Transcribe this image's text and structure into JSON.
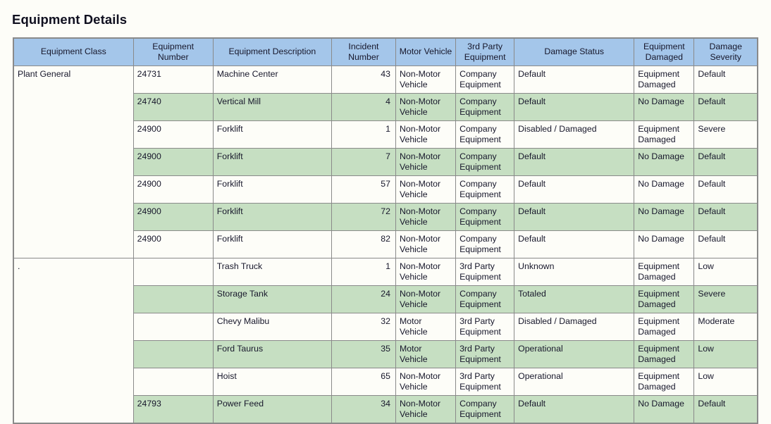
{
  "page": {
    "title": "Equipment Details"
  },
  "table": {
    "columns": [
      {
        "key": "equipment_class",
        "label": "Equipment Class"
      },
      {
        "key": "equipment_number",
        "label": "Equipment\nNumber"
      },
      {
        "key": "equipment_description",
        "label": "Equipment Description"
      },
      {
        "key": "incident_number",
        "label": "Incident\nNumber"
      },
      {
        "key": "motor_vehicle",
        "label": "Motor Vehicle"
      },
      {
        "key": "third_party_equipment",
        "label": "3rd Party\nEquipment"
      },
      {
        "key": "damage_status",
        "label": "Damage Status"
      },
      {
        "key": "equipment_damaged",
        "label": "Equipment\nDamaged"
      },
      {
        "key": "damage_severity",
        "label": "Damage\nSeverity"
      }
    ],
    "header_labels": {
      "equipment_class": "Equipment Class",
      "equipment_number_l1": "Equipment",
      "equipment_number_l2": "Number",
      "equipment_description": "Equipment Description",
      "incident_number_l1": "Incident",
      "incident_number_l2": "Number",
      "motor_vehicle": "Motor Vehicle",
      "third_party_l1": "3rd Party",
      "third_party_l2": "Equipment",
      "damage_status": "Damage Status",
      "equipment_damaged_l1": "Equipment",
      "equipment_damaged_l2": "Damaged",
      "damage_severity_l1": "Damage",
      "damage_severity_l2": "Severity"
    },
    "groups": [
      {
        "equipment_class": "Plant General",
        "rows": [
          {
            "equipment_number": "24731",
            "equipment_description": "Machine Center",
            "incident_number": "43",
            "motor_vehicle": "Non-Motor Vehicle",
            "third_party_equipment": "Company Equipment",
            "damage_status": "Default",
            "equipment_damaged": "Equipment Damaged",
            "damage_severity": "Default",
            "alt": false
          },
          {
            "equipment_number": "24740",
            "equipment_description": "Vertical Mill",
            "incident_number": "4",
            "motor_vehicle": "Non-Motor Vehicle",
            "third_party_equipment": "Company Equipment",
            "damage_status": "Default",
            "equipment_damaged": "No Damage",
            "damage_severity": "Default",
            "alt": true
          },
          {
            "equipment_number": "24900",
            "equipment_description": "Forklift",
            "incident_number": "1",
            "motor_vehicle": "Non-Motor Vehicle",
            "third_party_equipment": "Company Equipment",
            "damage_status": "Disabled / Damaged",
            "equipment_damaged": "Equipment Damaged",
            "damage_severity": "Severe",
            "alt": false
          },
          {
            "equipment_number": "24900",
            "equipment_description": "Forklift",
            "incident_number": "7",
            "motor_vehicle": "Non-Motor Vehicle",
            "third_party_equipment": "Company Equipment",
            "damage_status": "Default",
            "equipment_damaged": "No Damage",
            "damage_severity": "Default",
            "alt": true
          },
          {
            "equipment_number": "24900",
            "equipment_description": "Forklift",
            "incident_number": "57",
            "motor_vehicle": "Non-Motor Vehicle",
            "third_party_equipment": "Company Equipment",
            "damage_status": "Default",
            "equipment_damaged": "No Damage",
            "damage_severity": "Default",
            "alt": false
          },
          {
            "equipment_number": "24900",
            "equipment_description": "Forklift",
            "incident_number": "72",
            "motor_vehicle": "Non-Motor Vehicle",
            "third_party_equipment": "Company Equipment",
            "damage_status": "Default",
            "equipment_damaged": "No Damage",
            "damage_severity": "Default",
            "alt": true
          },
          {
            "equipment_number": "24900",
            "equipment_description": "Forklift",
            "incident_number": "82",
            "motor_vehicle": "Non-Motor Vehicle",
            "third_party_equipment": "Company Equipment",
            "damage_status": "Default",
            "equipment_damaged": "No Damage",
            "damage_severity": "Default",
            "alt": false
          }
        ]
      },
      {
        "equipment_class": ".",
        "rows": [
          {
            "equipment_number": "",
            "equipment_description": "Trash Truck",
            "incident_number": "1",
            "motor_vehicle": "Non-Motor Vehicle",
            "third_party_equipment": "3rd Party Equipment",
            "damage_status": "Unknown",
            "equipment_damaged": "Equipment Damaged",
            "damage_severity": "Low",
            "alt": false
          },
          {
            "equipment_number": "",
            "equipment_description": "Storage Tank",
            "incident_number": "24",
            "motor_vehicle": "Non-Motor Vehicle",
            "third_party_equipment": "Company Equipment",
            "damage_status": "Totaled",
            "equipment_damaged": "Equipment Damaged",
            "damage_severity": "Severe",
            "alt": true
          },
          {
            "equipment_number": "",
            "equipment_description": "Chevy Malibu",
            "incident_number": "32",
            "motor_vehicle": "Motor Vehicle",
            "third_party_equipment": "3rd Party Equipment",
            "damage_status": "Disabled / Damaged",
            "equipment_damaged": "Equipment Damaged",
            "damage_severity": "Moderate",
            "alt": false
          },
          {
            "equipment_number": "",
            "equipment_description": "Ford Taurus",
            "incident_number": "35",
            "motor_vehicle": "Motor Vehicle",
            "third_party_equipment": "3rd Party Equipment",
            "damage_status": "Operational",
            "equipment_damaged": "Equipment Damaged",
            "damage_severity": "Low",
            "alt": true
          },
          {
            "equipment_number": "",
            "equipment_description": "Hoist",
            "incident_number": "65",
            "motor_vehicle": "Non-Motor Vehicle",
            "third_party_equipment": "3rd Party Equipment",
            "damage_status": "Operational",
            "equipment_damaged": "Equipment Damaged",
            "damage_severity": "Low",
            "alt": false
          },
          {
            "equipment_number": "24793",
            "equipment_description": "Power Feed",
            "incident_number": "34",
            "motor_vehicle": "Non-Motor Vehicle",
            "third_party_equipment": "Company Equipment",
            "damage_status": "Default",
            "equipment_damaged": "No Damage",
            "damage_severity": "Default",
            "alt": true
          }
        ]
      }
    ]
  },
  "colors": {
    "header_blue": "#a4c6ea",
    "alt_row_green": "#c6dfc2",
    "border_gray": "#8a8a8a",
    "page_background": "#fdfdf8",
    "text": "#17172b"
  }
}
